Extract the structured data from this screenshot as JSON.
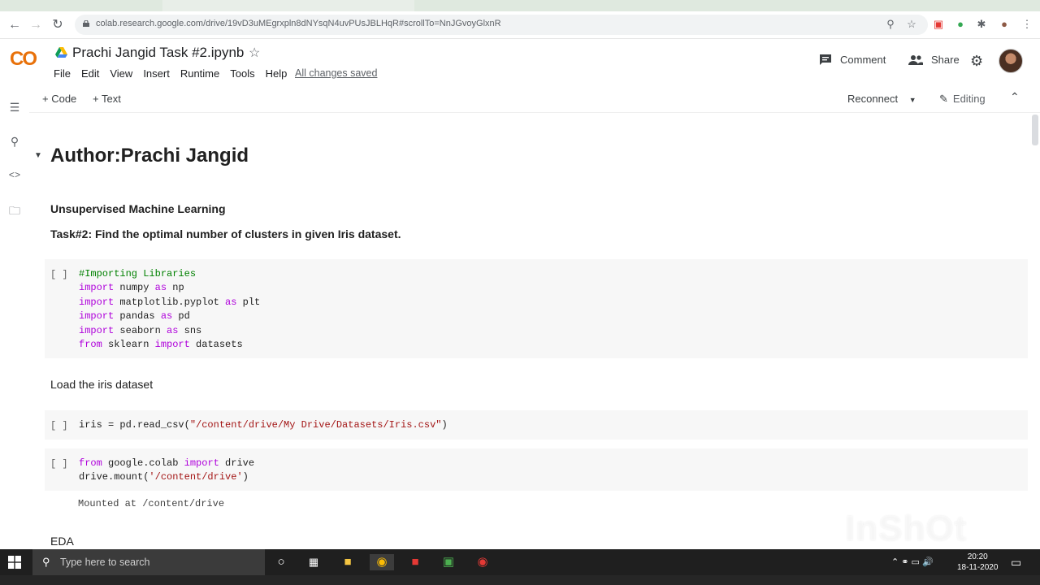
{
  "browser": {
    "url": "colab.research.google.com/drive/19vD3uMEgrxpln8dNYsqN4uvPUsJBLHqR#scrollTo=NnJGvoyGlxnR"
  },
  "header": {
    "logo": "CO",
    "title": "Prachi Jangid Task #2.ipynb",
    "menu": [
      "File",
      "Edit",
      "View",
      "Insert",
      "Runtime",
      "Tools",
      "Help"
    ],
    "save_status": "All changes saved",
    "comment_label": "Comment",
    "share_label": "Share"
  },
  "toolbar": {
    "add_code": "+ Code",
    "add_text": "+ Text",
    "reconnect": "Reconnect",
    "editing": "Editing"
  },
  "notebook": {
    "heading": "Author:Prachi Jangid",
    "subheading1": "Unsupervised Machine Learning",
    "subheading2": "Task#2: Find the optimal number of clusters in given Iris dataset.",
    "cell1_prompt": "[ ]",
    "cell1_lines": [
      "#Importing Libraries",
      "import numpy as np",
      "import matplotlib.pyplot as plt",
      "import pandas as pd",
      "import seaborn as sns",
      "from sklearn import datasets"
    ],
    "text_load": "Load the iris dataset",
    "cell2_prompt": "[ ]",
    "cell2_code": "iris = pd.read_csv(\"/content/drive/My Drive/Datasets/Iris.csv\")",
    "cell3_prompt": "[ ]",
    "cell3_lines": [
      "from google.colab import drive",
      "drive.mount('/content/drive')"
    ],
    "cell3_output": "Mounted at /content/drive",
    "text_eda": "EDA"
  },
  "watermark": "InShOt",
  "taskbar": {
    "search_placeholder": "Type here to search",
    "time": "20:20",
    "date": "18-11-2020"
  }
}
